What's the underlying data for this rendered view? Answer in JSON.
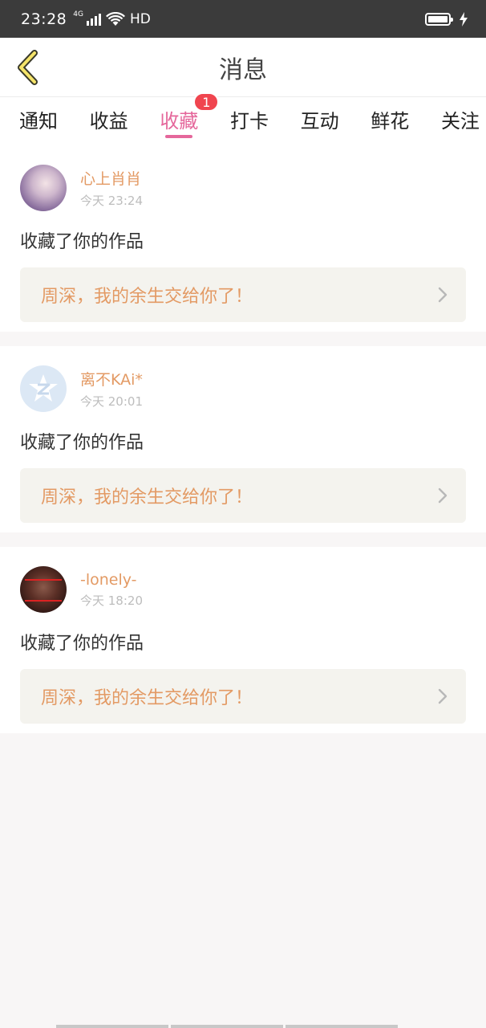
{
  "status_bar": {
    "time": "23:28",
    "network": "4G",
    "hd": "HD"
  },
  "header": {
    "title": "消息",
    "back_icon": "chevron-left-icon"
  },
  "tabs": [
    {
      "label": "通知"
    },
    {
      "label": "收益"
    },
    {
      "label": "收藏",
      "active": true,
      "badge": "1"
    },
    {
      "label": "打卡"
    },
    {
      "label": "互动"
    },
    {
      "label": "鲜花"
    },
    {
      "label": "关注"
    }
  ],
  "messages": [
    {
      "user": "心上肖肖",
      "time": "今天 23:24",
      "action": "收藏了你的作品",
      "work": "周深，我的余生交给你了！"
    },
    {
      "user": "离不KAi*",
      "time": "今天 20:01",
      "action": "收藏了你的作品",
      "work": "周深，我的余生交给你了！"
    },
    {
      "user": "-lonely-",
      "time": "今天 18:20",
      "action": "收藏了你的作品",
      "work": "周深，我的余生交给你了！"
    }
  ],
  "colors": {
    "accent": "#e5679b",
    "name": "#e39a64",
    "badge": "#f0454f"
  }
}
